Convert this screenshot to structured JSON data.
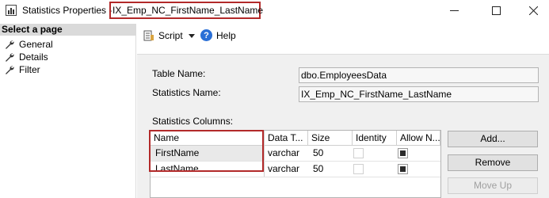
{
  "window": {
    "title_prefix": "Statistics Properties -",
    "title_name": "IX_Emp_NC_FirstName_LastName"
  },
  "left_pane": {
    "header": "Select a page",
    "items": [
      {
        "label": "General",
        "icon": "wrench-icon"
      },
      {
        "label": "Details",
        "icon": "wrench-icon"
      },
      {
        "label": "Filter",
        "icon": "wrench-icon"
      }
    ]
  },
  "toolbar": {
    "script_label": "Script",
    "help_label": "Help"
  },
  "form": {
    "table_name_label": "Table Name:",
    "table_name_value": "dbo.EmployeesData",
    "statistics_name_label": "Statistics Name:",
    "statistics_name_value": "IX_Emp_NC_FirstName_LastName",
    "statistics_columns_label": "Statistics Columns:"
  },
  "grid": {
    "headers": [
      "Name",
      "Data T...",
      "Size",
      "Identity",
      "Allow N..."
    ],
    "rows": [
      {
        "name": "FirstName",
        "data_type": "varchar",
        "size": "50",
        "identity": false,
        "allow_nulls": true
      },
      {
        "name": "LastName",
        "data_type": "varchar",
        "size": "50",
        "identity": false,
        "allow_nulls": true
      }
    ]
  },
  "buttons": {
    "add": "Add...",
    "remove": "Remove",
    "move_up": "Move Up"
  },
  "colors": {
    "highlight": "#b22a2a",
    "help_icon": "#2a6fd6"
  }
}
